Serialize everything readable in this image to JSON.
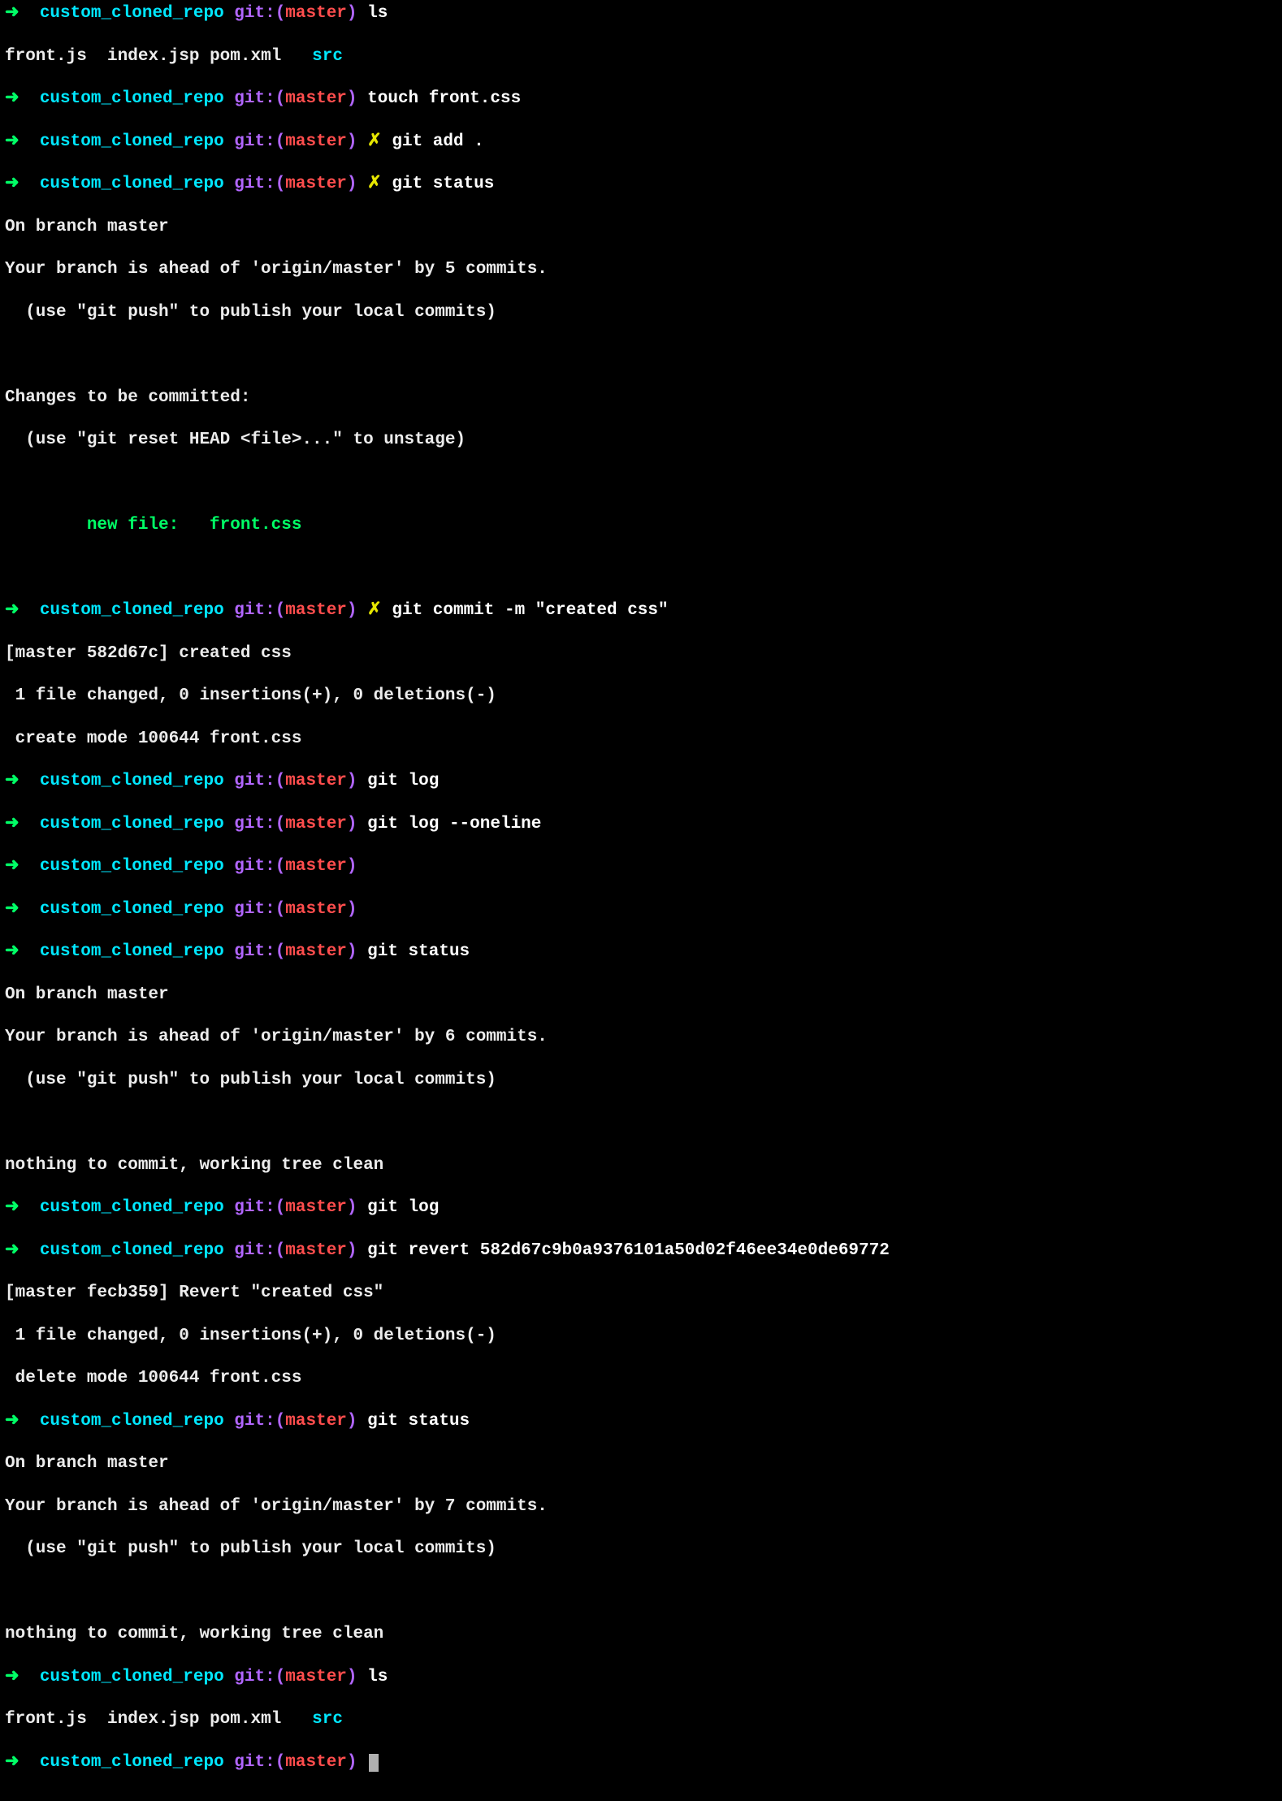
{
  "prompt": {
    "arrow": "➜",
    "dir": "custom_cloned_repo",
    "git_label": "git:(",
    "branch": "master",
    "git_close": ")",
    "dirty": "✗"
  },
  "lines": [
    {
      "type": "prompt",
      "dirty": false,
      "cmd": "ls"
    },
    {
      "type": "ls",
      "files": [
        "front.js",
        "index.jsp",
        "pom.xml"
      ],
      "dirs": [
        "src"
      ]
    },
    {
      "type": "prompt",
      "dirty": false,
      "cmd": "touch front.css"
    },
    {
      "type": "prompt",
      "dirty": true,
      "cmd": "git add ."
    },
    {
      "type": "prompt",
      "dirty": true,
      "cmd": "git status"
    },
    {
      "type": "out",
      "text": "On branch master"
    },
    {
      "type": "out",
      "text": "Your branch is ahead of 'origin/master' by 5 commits."
    },
    {
      "type": "out",
      "text": "  (use \"git push\" to publish your local commits)"
    },
    {
      "type": "blank"
    },
    {
      "type": "out",
      "text": "Changes to be committed:"
    },
    {
      "type": "out",
      "text": "  (use \"git reset HEAD <file>...\" to unstage)"
    },
    {
      "type": "blank"
    },
    {
      "type": "newfile",
      "text": "        new file:   front.css"
    },
    {
      "type": "blank"
    },
    {
      "type": "prompt",
      "dirty": true,
      "cmd": "git commit -m \"created css\""
    },
    {
      "type": "out",
      "text": "[master 582d67c] created css"
    },
    {
      "type": "out",
      "text": " 1 file changed, 0 insertions(+), 0 deletions(-)"
    },
    {
      "type": "out",
      "text": " create mode 100644 front.css"
    },
    {
      "type": "prompt",
      "dirty": false,
      "cmd": "git log"
    },
    {
      "type": "prompt",
      "dirty": false,
      "cmd": "git log --oneline"
    },
    {
      "type": "prompt",
      "dirty": false,
      "cmd": ""
    },
    {
      "type": "prompt",
      "dirty": false,
      "cmd": ""
    },
    {
      "type": "prompt",
      "dirty": false,
      "cmd": "git status"
    },
    {
      "type": "out",
      "text": "On branch master"
    },
    {
      "type": "out",
      "text": "Your branch is ahead of 'origin/master' by 6 commits."
    },
    {
      "type": "out",
      "text": "  (use \"git push\" to publish your local commits)"
    },
    {
      "type": "blank"
    },
    {
      "type": "out",
      "text": "nothing to commit, working tree clean"
    },
    {
      "type": "prompt",
      "dirty": false,
      "cmd": "git log"
    },
    {
      "type": "prompt",
      "dirty": false,
      "cmd": "git revert 582d67c9b0a9376101a50d02f46ee34e0de69772"
    },
    {
      "type": "out",
      "text": "[master fecb359] Revert \"created css\""
    },
    {
      "type": "out",
      "text": " 1 file changed, 0 insertions(+), 0 deletions(-)"
    },
    {
      "type": "out",
      "text": " delete mode 100644 front.css"
    },
    {
      "type": "prompt",
      "dirty": false,
      "cmd": "git status"
    },
    {
      "type": "out",
      "text": "On branch master"
    },
    {
      "type": "out",
      "text": "Your branch is ahead of 'origin/master' by 7 commits."
    },
    {
      "type": "out",
      "text": "  (use \"git push\" to publish your local commits)"
    },
    {
      "type": "blank"
    },
    {
      "type": "out",
      "text": "nothing to commit, working tree clean"
    },
    {
      "type": "prompt",
      "dirty": false,
      "cmd": "ls"
    },
    {
      "type": "ls",
      "files": [
        "front.js",
        "index.jsp",
        "pom.xml"
      ],
      "dirs": [
        "src"
      ]
    },
    {
      "type": "prompt",
      "dirty": false,
      "cmd": "",
      "cursor": true
    }
  ]
}
